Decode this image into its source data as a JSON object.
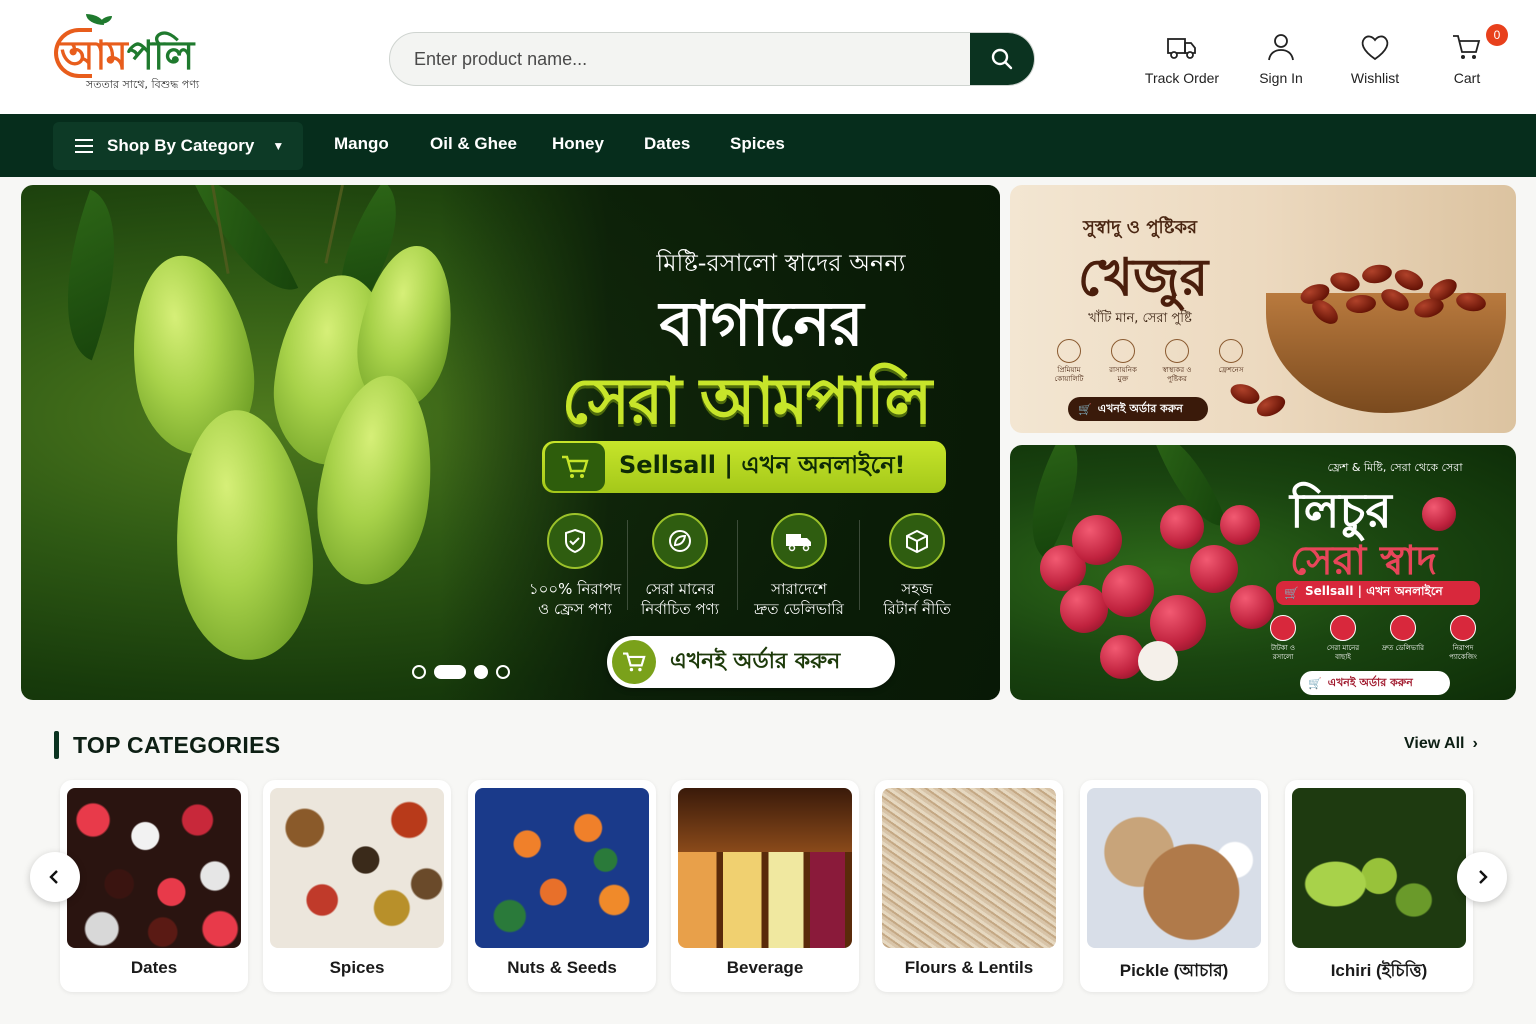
{
  "brand": {
    "name_part1": "আম",
    "name_part2": "পলি",
    "tagline": "সততার সাথে, বিশুদ্ধ পণ্য"
  },
  "search": {
    "placeholder": "Enter product name...",
    "icon": "search-icon"
  },
  "header_actions": [
    {
      "label": "Track Order",
      "icon": "truck-icon"
    },
    {
      "label": "Sign In",
      "icon": "user-icon"
    },
    {
      "label": "Wishlist",
      "icon": "heart-icon"
    },
    {
      "label": "Cart",
      "icon": "cart-icon",
      "badge": "0"
    }
  ],
  "nav": {
    "category_button": "Shop By Category",
    "links": [
      "Mango",
      "Oil & Ghee",
      "Honey",
      "Dates",
      "Spices"
    ]
  },
  "hero": {
    "subtitle": "মিষ্টি-রসালো স্বাদের অনন্য",
    "title_line1": "বাগানের",
    "title_line2": "সেরা আমপালি",
    "sell_bar": "Sellsall | এখন অনলাইনে!",
    "features": [
      {
        "line1": "১০০% নিরাপদ",
        "line2": "ও ফ্রেস পণ্য"
      },
      {
        "line1": "সেরা মানের",
        "line2": "নির্বাচিত পণ্য"
      },
      {
        "line1": "সারাদেশে",
        "line2": "দ্রুত ডেলিভারি"
      },
      {
        "line1": "সহজ",
        "line2": "রিটার্ন নীতি"
      }
    ],
    "order_button": "এখনই অর্ডার করুন",
    "slides": 4,
    "active_slide": 2
  },
  "banner_dates": {
    "subtitle": "সুস্বাদু ও পুষ্টিকর",
    "title": "খেজুর",
    "tagline": "খাঁটি মান, সেরা পুষ্টি",
    "features": [
      "প্রিমিয়াম কোয়ালিটি",
      "রাসায়নিক মুক্ত",
      "স্বাস্থ্যকর ও পুষ্টিকর",
      "ফ্রেশনেস"
    ],
    "button": "এখনই অর্ডার করুন"
  },
  "banner_lychee": {
    "subtitle": "ফ্রেশ & মিষ্টি, সেরা থেকে সেরা",
    "title": "লিচুর",
    "title_red": "সেরা স্বাদ",
    "sell_bar": "Sellsall | এখন অনলাইনে",
    "features": [
      "টাটকা ও রসালো",
      "সেরা মানের বাছাই",
      "দ্রুত ডেলিভারি",
      "নিরাপদ প্যাকেজিং"
    ],
    "button": "এখনই অর্ডার করুন"
  },
  "top_categories": {
    "title": "TOP CATEGORIES",
    "view_all": "View All",
    "items": [
      "Dates",
      "Spices",
      "Nuts & Seeds",
      "Beverage",
      "Flours & Lentils",
      "Pickle (আচার)",
      "Ichiri (ইচিত্তি)"
    ]
  },
  "colors": {
    "primary_dark": "#062d1c",
    "accent_lime": "#c7e52a",
    "badge_red": "#e8401c",
    "lychee_red": "#d8283c"
  }
}
